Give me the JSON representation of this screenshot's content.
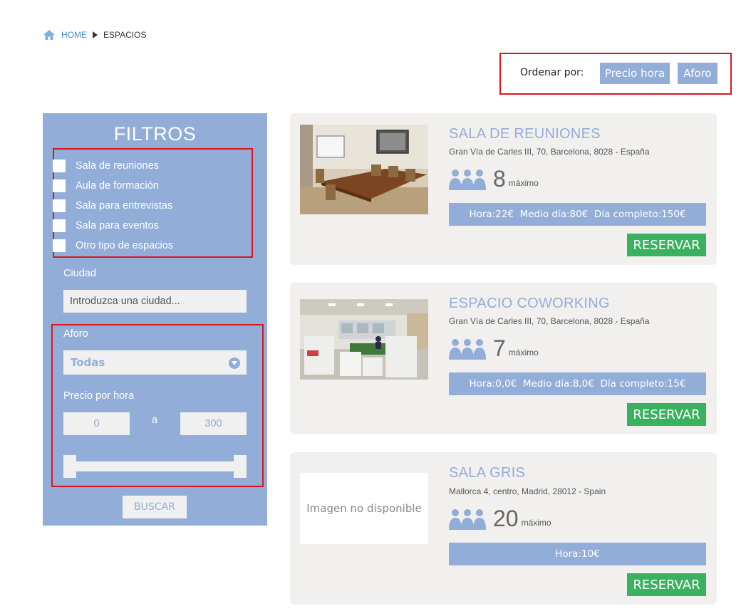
{
  "breadcrumb": {
    "home": "HOME",
    "current": "ESPACIOS"
  },
  "sort": {
    "label": "Ordenar por:",
    "options": [
      "Precio hora",
      "Aforo"
    ]
  },
  "filters": {
    "title": "FILTROS",
    "space_types": [
      {
        "label": "Sala de reuniones",
        "checked": false
      },
      {
        "label": "Aula de formación",
        "checked": false
      },
      {
        "label": "Sala para entrevistas",
        "checked": false
      },
      {
        "label": "Sala para eventos",
        "checked": false
      },
      {
        "label": "Otro tipo de espacios",
        "checked": false
      }
    ],
    "city": {
      "label": "Ciudad",
      "placeholder": "Introduzca una ciudad..."
    },
    "aforo": {
      "label": "Aforo",
      "selected": "Todas"
    },
    "price": {
      "label": "Precio por hora",
      "min": "0",
      "separator": "a",
      "max": "300"
    },
    "search_button": "BUSCAR"
  },
  "results": [
    {
      "title": "SALA DE REUNIONES",
      "address": "Gran Vía de Carles III, 70, Barcelona, 8028 - España",
      "capacity": "8",
      "capacity_suffix": "máximo",
      "prices": "Hora:22€  Medio día:80€  Día completo:150€",
      "image": "meeting-room-photo",
      "button": "RESERVAR"
    },
    {
      "title": "ESPACIO COWORKING",
      "address": "Gran Vía de Carles III, 70, Barcelona, 8028 - España",
      "capacity": "7",
      "capacity_suffix": "máximo",
      "prices": "Hora:0,0€  Medio día:8,0€  Día completo:15€",
      "image": "coworking-office-photo",
      "button": "RESERVAR"
    },
    {
      "title": "SALA GRIS",
      "address": "Mallorca 4, centro, Madrid, 28012 - Spain",
      "capacity": "20",
      "capacity_suffix": "máximo",
      "prices": "Hora:10€",
      "image_placeholder": "Imagen no disponible",
      "button": "RESERVAR"
    }
  ],
  "colors": {
    "accent": "#92add7",
    "reserve_green": "#39b15f",
    "highlight_red": "#d9171d",
    "card_bg": "#f1f0ef",
    "link_blue": "#3f8fc8"
  },
  "icons": [
    "home-icon",
    "breadcrumb-arrow-icon",
    "chevron-down-icon",
    "people-icon"
  ]
}
